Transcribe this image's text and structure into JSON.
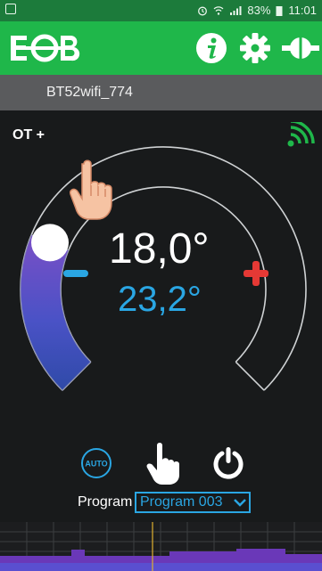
{
  "status_bar": {
    "battery": "83%",
    "time": "11:01",
    "icons": [
      "alarm-icon",
      "wifi-signal-icon",
      "cell-signal-icon",
      "battery-icon"
    ]
  },
  "app_bar": {
    "logo": "EOB",
    "buttons": [
      "info-icon",
      "gear-icon",
      "plug-icon"
    ],
    "colors": {
      "background": "#1fb74a",
      "status": "#1c7b3b"
    }
  },
  "device": {
    "name": "BT52wifi_774"
  },
  "thermostat": {
    "mode": "OT +",
    "set_temperature": "18,0°",
    "actual_temperature": "23,2°",
    "set_level": 0.25,
    "colors": {
      "actual": "#2aa6e3",
      "plus": "#e53935",
      "minus": "#2aa6e3"
    }
  },
  "controls": {
    "auto_label": "AUTO",
    "buttons": [
      "auto-button",
      "manual-hand-button",
      "power-button"
    ]
  },
  "program": {
    "label": "Program",
    "selected": "Program 003"
  }
}
